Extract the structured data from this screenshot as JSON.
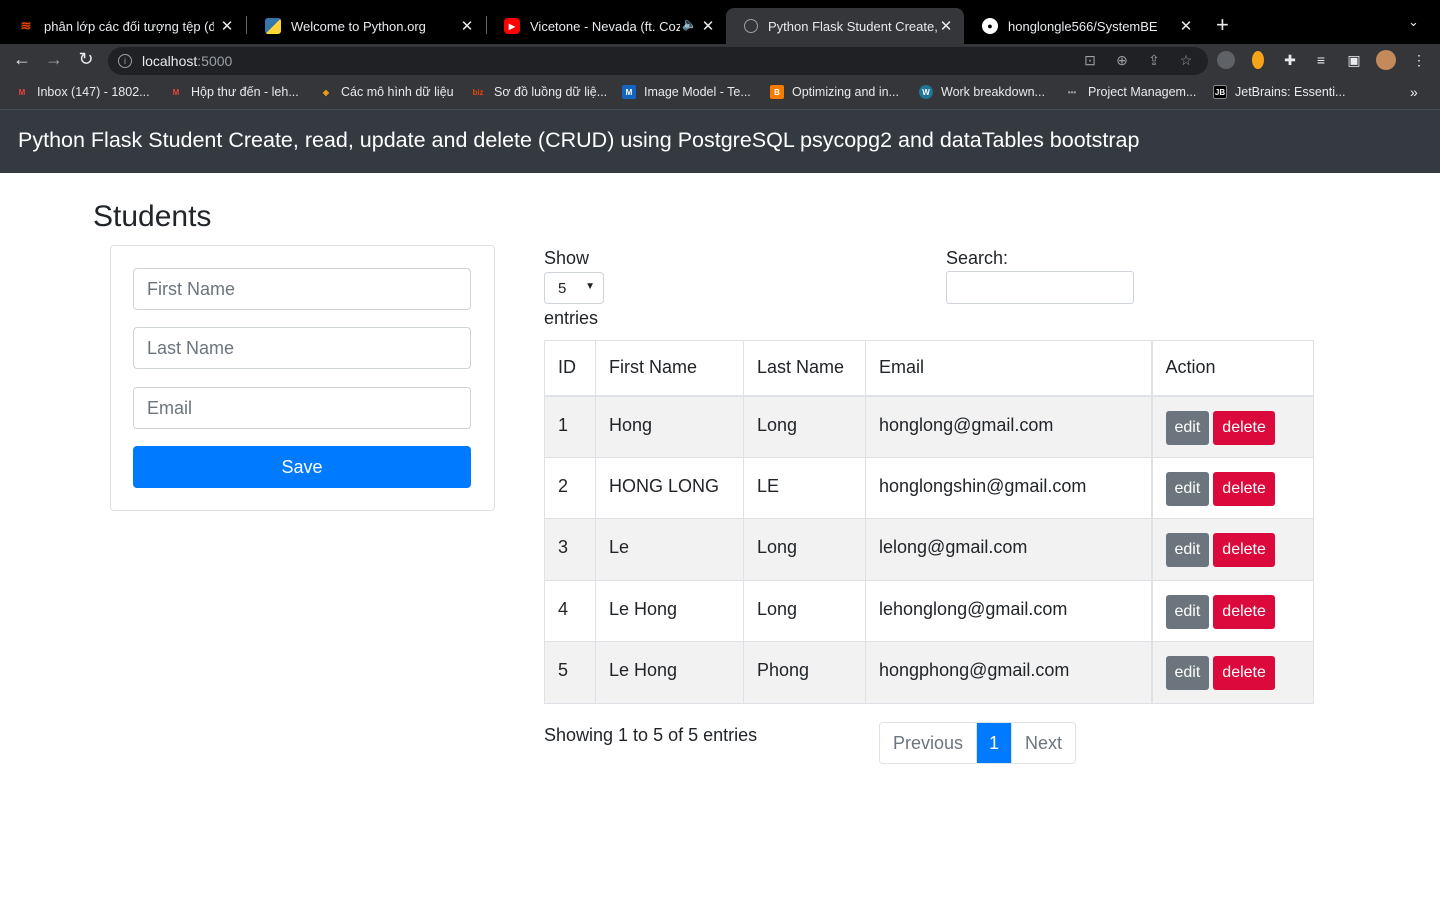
{
  "browser": {
    "tabs": [
      {
        "title": "phân lớp các đối tượng tệp (để",
        "favicon_color": "#e8430a"
      },
      {
        "title": "Welcome to Python.org",
        "favicon_color": "#ffd43b"
      },
      {
        "title": "Vicetone - Nevada (ft. Cozi",
        "favicon_color": "#ff0000"
      },
      {
        "title": "Python Flask Student Create, r",
        "favicon_color": "#9aa0a6"
      },
      {
        "title": "honglongle566/SystemBE",
        "favicon_color": "#ffffff"
      }
    ],
    "url_host": "localhost",
    "url_port": ":5000",
    "bookmarks": [
      {
        "label": "Inbox (147) - 1802...",
        "color": "#ea4335",
        "glyph": "M"
      },
      {
        "label": "Hộp thư đến - leh...",
        "color": "#ea4335",
        "glyph": "M"
      },
      {
        "label": "Các mô hình dữ liệu",
        "color": "#f4a416",
        "glyph": "◈"
      },
      {
        "label": "Sơ đồ luồng dữ liệ...",
        "color": "#e8430a",
        "glyph": "biz"
      },
      {
        "label": "Image Model - Te...",
        "color": "#1565c0",
        "glyph": "M"
      },
      {
        "label": "Optimizing and in...",
        "color": "#f57c00",
        "glyph": "B"
      },
      {
        "label": "Work breakdown...",
        "color": "#21759b",
        "glyph": "W"
      },
      {
        "label": "Project Managem...",
        "color": "#555555",
        "glyph": "•••"
      },
      {
        "label": "JetBrains: Essenti...",
        "color": "#000000",
        "glyph": "JB"
      }
    ]
  },
  "navbar": {
    "title": "Python Flask Student Create, read, update and delete (CRUD) using PostgreSQL psycopg2 and dataTables bootstrap"
  },
  "page": {
    "heading": "Students"
  },
  "form": {
    "first_name_placeholder": "First Name",
    "last_name_placeholder": "Last Name",
    "email_placeholder": "Email",
    "save_label": "Save"
  },
  "datatable": {
    "show_label": "Show",
    "page_length": "5",
    "entries_label": "entries",
    "search_label": "Search:",
    "columns": [
      "ID",
      "First Name",
      "Last Name",
      "Email",
      "Action"
    ],
    "rows": [
      {
        "id": "1",
        "first": "Hong",
        "last": "Long",
        "email": "honglong@gmail.com"
      },
      {
        "id": "2",
        "first": "HONG LONG",
        "last": "LE",
        "email": "honglongshin@gmail.com"
      },
      {
        "id": "3",
        "first": "Le",
        "last": "Long",
        "email": "lelong@gmail.com"
      },
      {
        "id": "4",
        "first": "Le Hong",
        "last": "Long",
        "email": "lehonglong@gmail.com"
      },
      {
        "id": "5",
        "first": "Le Hong",
        "last": "Phong",
        "email": "hongphong@gmail.com"
      }
    ],
    "edit_label": "edit",
    "delete_label": "delete",
    "info": "Showing 1 to 5 of 5 entries",
    "pagination": {
      "previous": "Previous",
      "current": "1",
      "next": "Next"
    }
  }
}
